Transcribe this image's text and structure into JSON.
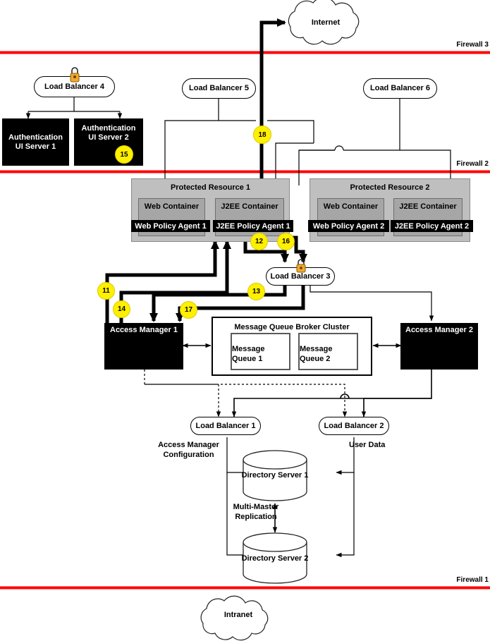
{
  "diagram": {
    "title": "Access Manager Multi-Tier Deployment Architecture",
    "colors": {
      "firewall_line": "#ff0000",
      "badge_fill": "#ffef00",
      "server_fill": "#000000",
      "protected_resource_fill": "#bfbfbf",
      "container_fill": "#a6a6a6",
      "lock_icon": "#f0a830"
    }
  },
  "clouds": [
    {
      "id": "internet",
      "label": "Internet"
    },
    {
      "id": "intranet",
      "label": "Intranet"
    }
  ],
  "firewalls": [
    {
      "id": "fw3",
      "label": "Firewall 3"
    },
    {
      "id": "fw2",
      "label": "Firewall 2"
    },
    {
      "id": "fw1",
      "label": "Firewall 1"
    }
  ],
  "load_balancers": [
    {
      "id": "lb1",
      "label": "Load Balancer 1",
      "has_lock": false
    },
    {
      "id": "lb2",
      "label": "Load Balancer 2",
      "has_lock": false
    },
    {
      "id": "lb3",
      "label": "Load Balancer 3",
      "has_lock": true
    },
    {
      "id": "lb4",
      "label": "Load Balancer 4",
      "has_lock": true
    },
    {
      "id": "lb5",
      "label": "Load Balancer 5",
      "has_lock": false
    },
    {
      "id": "lb6",
      "label": "Load Balancer 6",
      "has_lock": false
    }
  ],
  "auth_servers": [
    {
      "id": "auth1",
      "line1": "Authentication",
      "line2": "UI Server  1"
    },
    {
      "id": "auth2",
      "line1": "Authentication",
      "line2": "UI  Server 2"
    }
  ],
  "protected_resources": [
    {
      "id": "pr1",
      "title": "Protected Resource  1",
      "web_container": "Web Container",
      "j2ee_container": "J2EE Container",
      "web_agent": "Web Policy Agent 1",
      "j2ee_agent": "J2EE Policy Agent 1"
    },
    {
      "id": "pr2",
      "title": "Protected Resource  2",
      "web_container": "Web Container",
      "j2ee_container": "J2EE Container",
      "web_agent": "Web Policy Agent 2",
      "j2ee_agent": "J2EE Policy Agent 2"
    }
  ],
  "access_managers": [
    {
      "id": "am1",
      "label": "Access Manager 1"
    },
    {
      "id": "am2",
      "label": "Access Manager 2"
    }
  ],
  "message_queue": {
    "cluster_title": "Message Queue Broker Cluster",
    "queues": [
      {
        "id": "mq1",
        "line1": "Message",
        "line2": "Queue 1"
      },
      {
        "id": "mq2",
        "line1": "Message",
        "line2": "Queue 2"
      }
    ]
  },
  "directory_servers": [
    {
      "id": "ds1",
      "label": "Directory Server 1"
    },
    {
      "id": "ds2",
      "label": "Directory Server 2"
    }
  ],
  "annotations": [
    {
      "id": "am-config",
      "line1": "Access Manager",
      "line2": "Configuration"
    },
    {
      "id": "user-data",
      "line1": "User Data",
      "line2": ""
    },
    {
      "id": "multimaster",
      "line1": "Multi-Master",
      "line2": "Replication"
    }
  ],
  "step_badges": [
    {
      "id": "b11",
      "number": "11"
    },
    {
      "id": "b12",
      "number": "12"
    },
    {
      "id": "b13",
      "number": "13"
    },
    {
      "id": "b14",
      "number": "14"
    },
    {
      "id": "b15",
      "number": "15"
    },
    {
      "id": "b16",
      "number": "16"
    },
    {
      "id": "b17",
      "number": "17"
    },
    {
      "id": "b18",
      "number": "18"
    }
  ]
}
